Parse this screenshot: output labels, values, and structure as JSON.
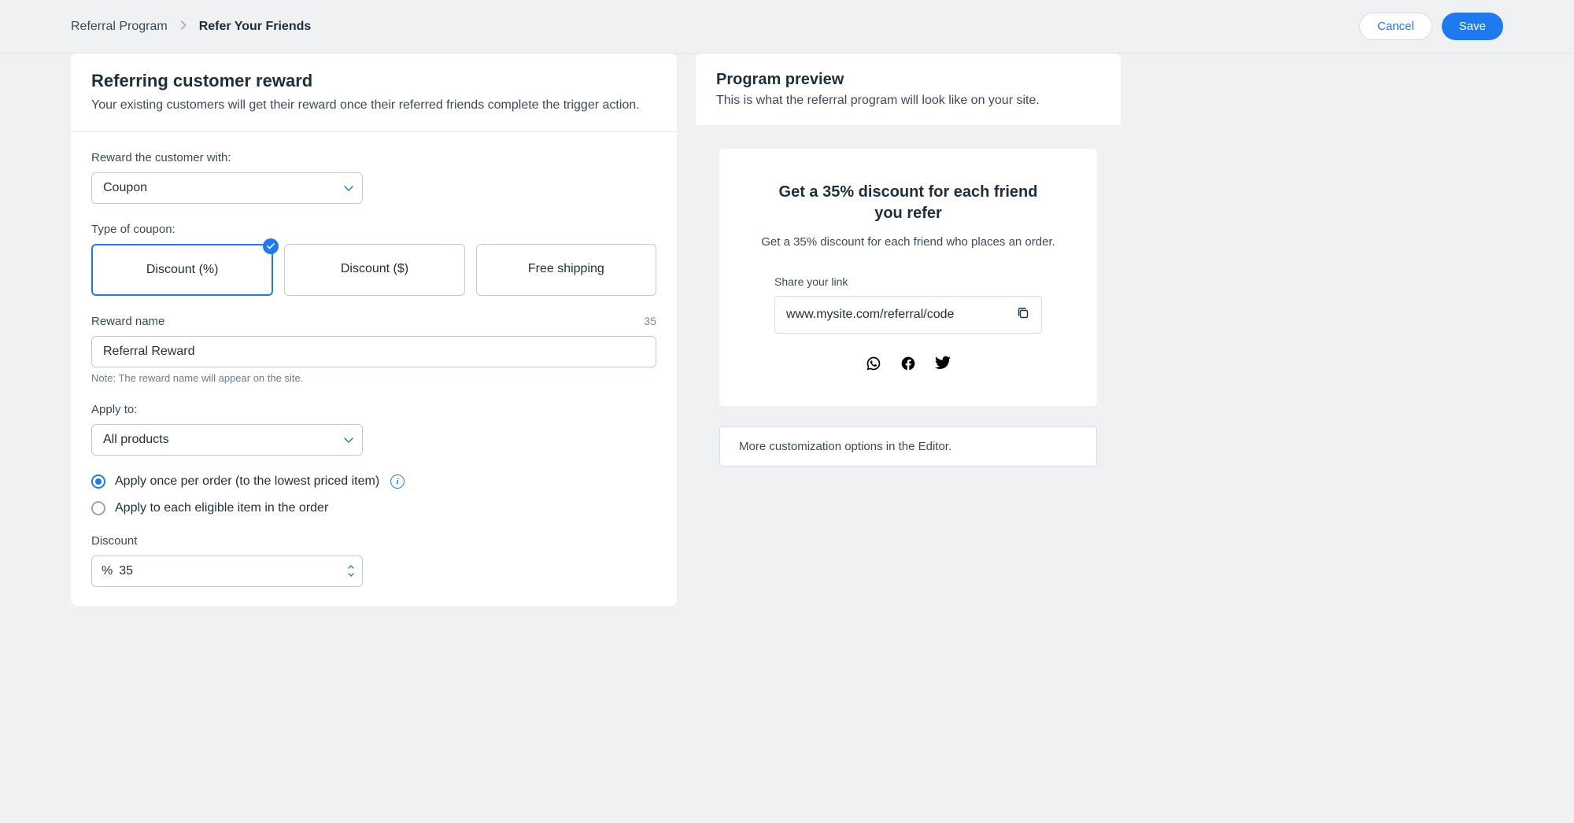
{
  "header": {
    "breadcrumb_parent": "Referral Program",
    "breadcrumb_current": "Refer Your Friends",
    "cancel_label": "Cancel",
    "save_label": "Save"
  },
  "form": {
    "title": "Referring customer reward",
    "subtitle": "Your existing customers will get their reward once their referred friends complete the trigger action.",
    "reward_with_label": "Reward the customer with:",
    "reward_with_value": "Coupon",
    "coupon_type_label": "Type of coupon:",
    "coupon_types": {
      "percent": "Discount (%)",
      "amount": "Discount ($)",
      "shipping": "Free shipping"
    },
    "reward_name_label": "Reward name",
    "reward_name_counter": "35",
    "reward_name_value": "Referral Reward",
    "reward_name_note": "Note: The reward name will appear on the site.",
    "apply_to_label": "Apply to:",
    "apply_to_value": "All products",
    "radio_once": "Apply once per order (to the lowest priced item)",
    "radio_each": "Apply to each eligible item in the order",
    "discount_label": "Discount",
    "discount_prefix": "%",
    "discount_value": "35"
  },
  "preview": {
    "title": "Program preview",
    "subtitle": "This is what the referral program will look like on your site.",
    "card_title": "Get a 35% discount for each friend you refer",
    "card_sub": "Get a 35% discount for each friend who places an order.",
    "share_label": "Share your link",
    "share_link": "www.mysite.com/referral/code",
    "editor_note": "More customization options in the Editor."
  }
}
